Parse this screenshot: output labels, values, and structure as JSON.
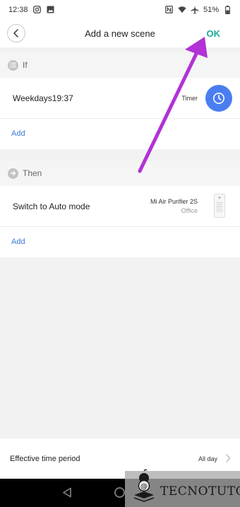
{
  "status_bar": {
    "time": "12:38",
    "battery": "51%",
    "icons": [
      "instagram-icon",
      "gallery-icon",
      "nfc-icon",
      "wifi-icon",
      "airplane-icon",
      "battery-icon"
    ]
  },
  "header": {
    "title": "Add a new scene",
    "ok_label": "OK",
    "back_icon": "chevron-left-icon"
  },
  "if_section": {
    "label": "If",
    "icon": "list-icon",
    "condition": {
      "label": "Weekdays19:37",
      "type_label": "Timer",
      "icon": "clock-icon",
      "icon_color": "#4a7ef0"
    },
    "add_label": "Add"
  },
  "then_section": {
    "label": "Then",
    "icon": "arrow-right-icon",
    "action": {
      "label": "Switch to Auto mode",
      "device_name": "Mi Air Purifier 2S",
      "device_room": "Office"
    },
    "add_label": "Add"
  },
  "effective_time": {
    "label": "Effective time period",
    "value": "All day"
  },
  "watermark": {
    "text": "TECNOTUTO"
  },
  "colors": {
    "accent": "#1aab9a",
    "link": "#3a7bd5",
    "annotation_arrow": "#b232d6"
  }
}
